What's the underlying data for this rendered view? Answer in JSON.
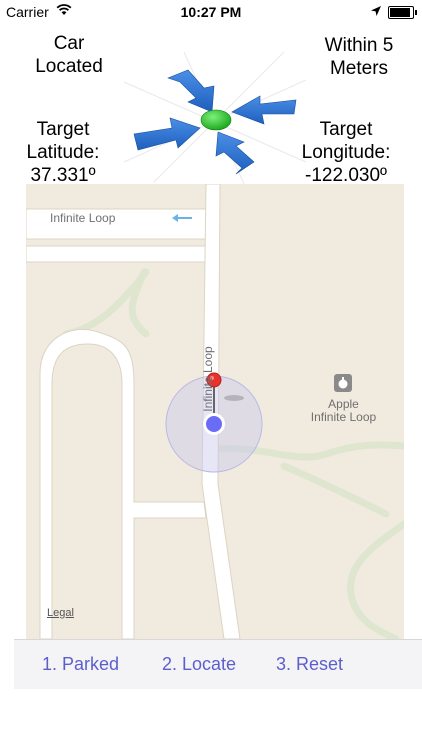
{
  "status_bar": {
    "carrier": "Carrier",
    "time": "10:27 PM",
    "wifi_icon": "wifi-icon",
    "location_icon": "location-arrow-icon",
    "battery_icon": "battery-icon",
    "battery_level": 1.0
  },
  "header": {
    "car_status_line1": "Car",
    "car_status_line2": "Located",
    "distance_line1": "Within 5",
    "distance_line2": "Meters",
    "latitude_label": "Target",
    "latitude_label2": "Latitude:",
    "latitude_value": "37.331º",
    "longitude_label": "Target",
    "longitude_label2": "Longitude:",
    "longitude_value": "-122.030º",
    "graphic_icon": "converging-arrows-target-icon"
  },
  "map": {
    "street_horizontal": "Infinite Loop",
    "street_vertical": "Infinite Loop",
    "poi_name_line1": "Apple",
    "poi_name_line2": "Infinite Loop",
    "poi_icon": "apple-logo-icon",
    "legal_link": "Legal",
    "pin_icon": "red-map-pin-icon",
    "user_location_icon": "blue-location-dot-icon",
    "colors": {
      "land": "#f1ebdf",
      "road": "#ffffff",
      "road_border": "#dcd4c4",
      "park_path": "#dfe6cf",
      "accuracy_circle": "#c8c8ee",
      "user_dot": "#6a6cf5",
      "pin": "#e8322c"
    }
  },
  "toolbar": {
    "parked_label": "1. Parked",
    "locate_label": "2.  Locate",
    "reset_label": "3. Reset",
    "accent_color": "#5c5fcb"
  }
}
